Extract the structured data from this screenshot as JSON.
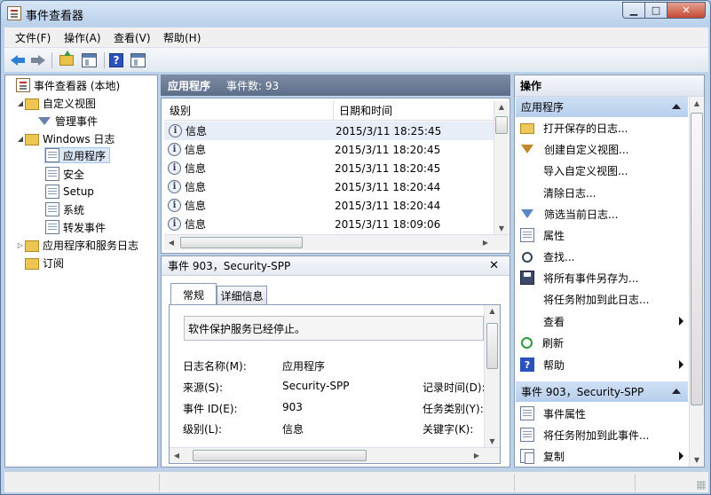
{
  "window": {
    "title": "事件查看器",
    "min": "▁",
    "max": "□",
    "close": "✕"
  },
  "menu": [
    "文件(F)",
    "操作(A)",
    "查看(V)",
    "帮助(H)"
  ],
  "tree": [
    {
      "label": "事件查看器 (本地)",
      "icon": "event-viewer-icon"
    },
    {
      "label": "自定义视图",
      "icon": "folder-icon"
    },
    {
      "label": "管理事件",
      "icon": "filter-icon"
    },
    {
      "label": "Windows 日志",
      "icon": "folder-icon"
    },
    {
      "label": "应用程序",
      "icon": "log-icon"
    },
    {
      "label": "安全",
      "icon": "log-icon"
    },
    {
      "label": "Setup",
      "icon": "log-icon"
    },
    {
      "label": "系统",
      "icon": "log-icon"
    },
    {
      "label": "转发事件",
      "icon": "log-icon"
    },
    {
      "label": "应用程序和服务日志",
      "icon": "folder-icon"
    },
    {
      "label": "订阅",
      "icon": "subscription-icon"
    }
  ],
  "center": {
    "title": "应用程序",
    "count": "事件数: 93",
    "columns": [
      "级别",
      "日期和时间"
    ],
    "rows": [
      {
        "level": "信息",
        "date": "2015/3/11 18:25:45"
      },
      {
        "level": "信息",
        "date": "2015/3/11 18:20:45"
      },
      {
        "level": "信息",
        "date": "2015/3/11 18:20:45"
      },
      {
        "level": "信息",
        "date": "2015/3/11 18:20:44"
      },
      {
        "level": "信息",
        "date": "2015/3/11 18:20:44"
      },
      {
        "level": "信息",
        "date": "2015/3/11 18:09:06"
      }
    ]
  },
  "detail": {
    "title": "事件 903，Security-SPP",
    "close": "✕",
    "tabs": [
      "常规",
      "详细信息"
    ],
    "message": "软件保护服务已经停止。",
    "props": [
      {
        "label": "日志名称(M):",
        "value": "应用程序"
      },
      {
        "label": "来源(S):",
        "value": "Security-SPP",
        "label2": "记录时间(D):"
      },
      {
        "label": "事件 ID(E):",
        "value": "903",
        "label2": "任务类别(Y):"
      },
      {
        "label": "级别(L):",
        "value": "信息",
        "label2": "关键字(K):"
      }
    ]
  },
  "actions": {
    "header": "操作",
    "group1": "应用程序",
    "items1": [
      {
        "label": "打开保存的日志...",
        "icon": "open-folder-icon"
      },
      {
        "label": "创建自定义视图...",
        "icon": "filter-icon"
      },
      {
        "label": "导入自定义视图...",
        "icon": ""
      },
      {
        "label": "清除日志...",
        "icon": ""
      },
      {
        "label": "筛选当前日志...",
        "icon": "filter-icon"
      },
      {
        "label": "属性",
        "icon": "properties-icon"
      },
      {
        "label": "查找...",
        "icon": "find-icon"
      },
      {
        "label": "将所有事件另存为...",
        "icon": "save-icon"
      },
      {
        "label": "将任务附加到此日志...",
        "icon": ""
      },
      {
        "label": "查看",
        "icon": "",
        "submenu": true
      },
      {
        "label": "刷新",
        "icon": "refresh-icon"
      },
      {
        "label": "帮助",
        "icon": "help-icon",
        "submenu": true
      }
    ],
    "group2": "事件 903，Security-SPP",
    "items2": [
      {
        "label": "事件属性",
        "icon": "properties-icon"
      },
      {
        "label": "将任务附加到此事件...",
        "icon": "attach-task-icon"
      },
      {
        "label": "复制",
        "icon": "copy-icon",
        "submenu": true
      }
    ]
  }
}
